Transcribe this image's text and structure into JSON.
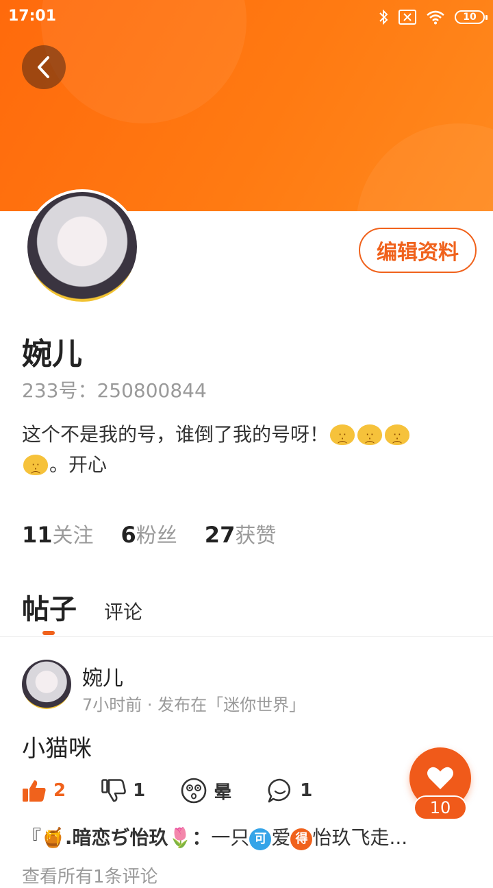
{
  "status_bar": {
    "time": "17:01",
    "battery": "10"
  },
  "profile": {
    "edit_label": "编辑资料",
    "name": "婉儿",
    "id_text": "233号：250800844",
    "bio_line1": "这个不是我的号，谁倒了我的号呀！",
    "bio_line2": "。开心",
    "stats": [
      {
        "num": "11",
        "label": "关注"
      },
      {
        "num": "6",
        "label": "粉丝"
      },
      {
        "num": "27",
        "label": "获赞"
      }
    ]
  },
  "tabs": {
    "posts": "帖子",
    "comments": "评论"
  },
  "post": {
    "author": "婉儿",
    "meta": "7小时前 · 发布在「迷你世界」",
    "text": "小猫咪",
    "like_count": "2",
    "dislike_count": "1",
    "dizzy_label": "晕",
    "comment_count": "1",
    "comment_preview": {
      "prefix": "『",
      "user": ".暗恋ぢ怡玖",
      "colon": "：",
      "text1": "一只",
      "badge1": "可",
      "text2": "爱",
      "badge2": "得",
      "text3": "怡玖飞走..."
    },
    "view_all": "查看所有1条评论"
  },
  "fab": {
    "count": "10"
  },
  "colors": {
    "accent": "#f0621c",
    "header": "#ff7a12"
  }
}
